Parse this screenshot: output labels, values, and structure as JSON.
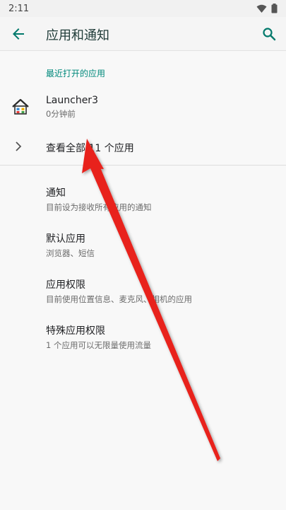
{
  "status_bar": {
    "time": "2:11"
  },
  "app_bar": {
    "title": "应用和通知"
  },
  "recent": {
    "section_label": "最近打开的应用",
    "apps": [
      {
        "name": "Launcher3",
        "time": "0分钟前"
      }
    ],
    "see_all": "查看全部 11 个应用"
  },
  "settings": [
    {
      "title": "通知",
      "subtitle": "目前设为接收所有应用的通知"
    },
    {
      "title": "默认应用",
      "subtitle": "浏览器、短信"
    },
    {
      "title": "应用权限",
      "subtitle": "目前使用位置信息、麦克风、相机的应用"
    },
    {
      "title": "特殊应用权限",
      "subtitle": "1 个应用可以无限量使用流量"
    }
  ],
  "colors": {
    "accent": "#00897b",
    "annotation_arrow": "#e8231f"
  }
}
